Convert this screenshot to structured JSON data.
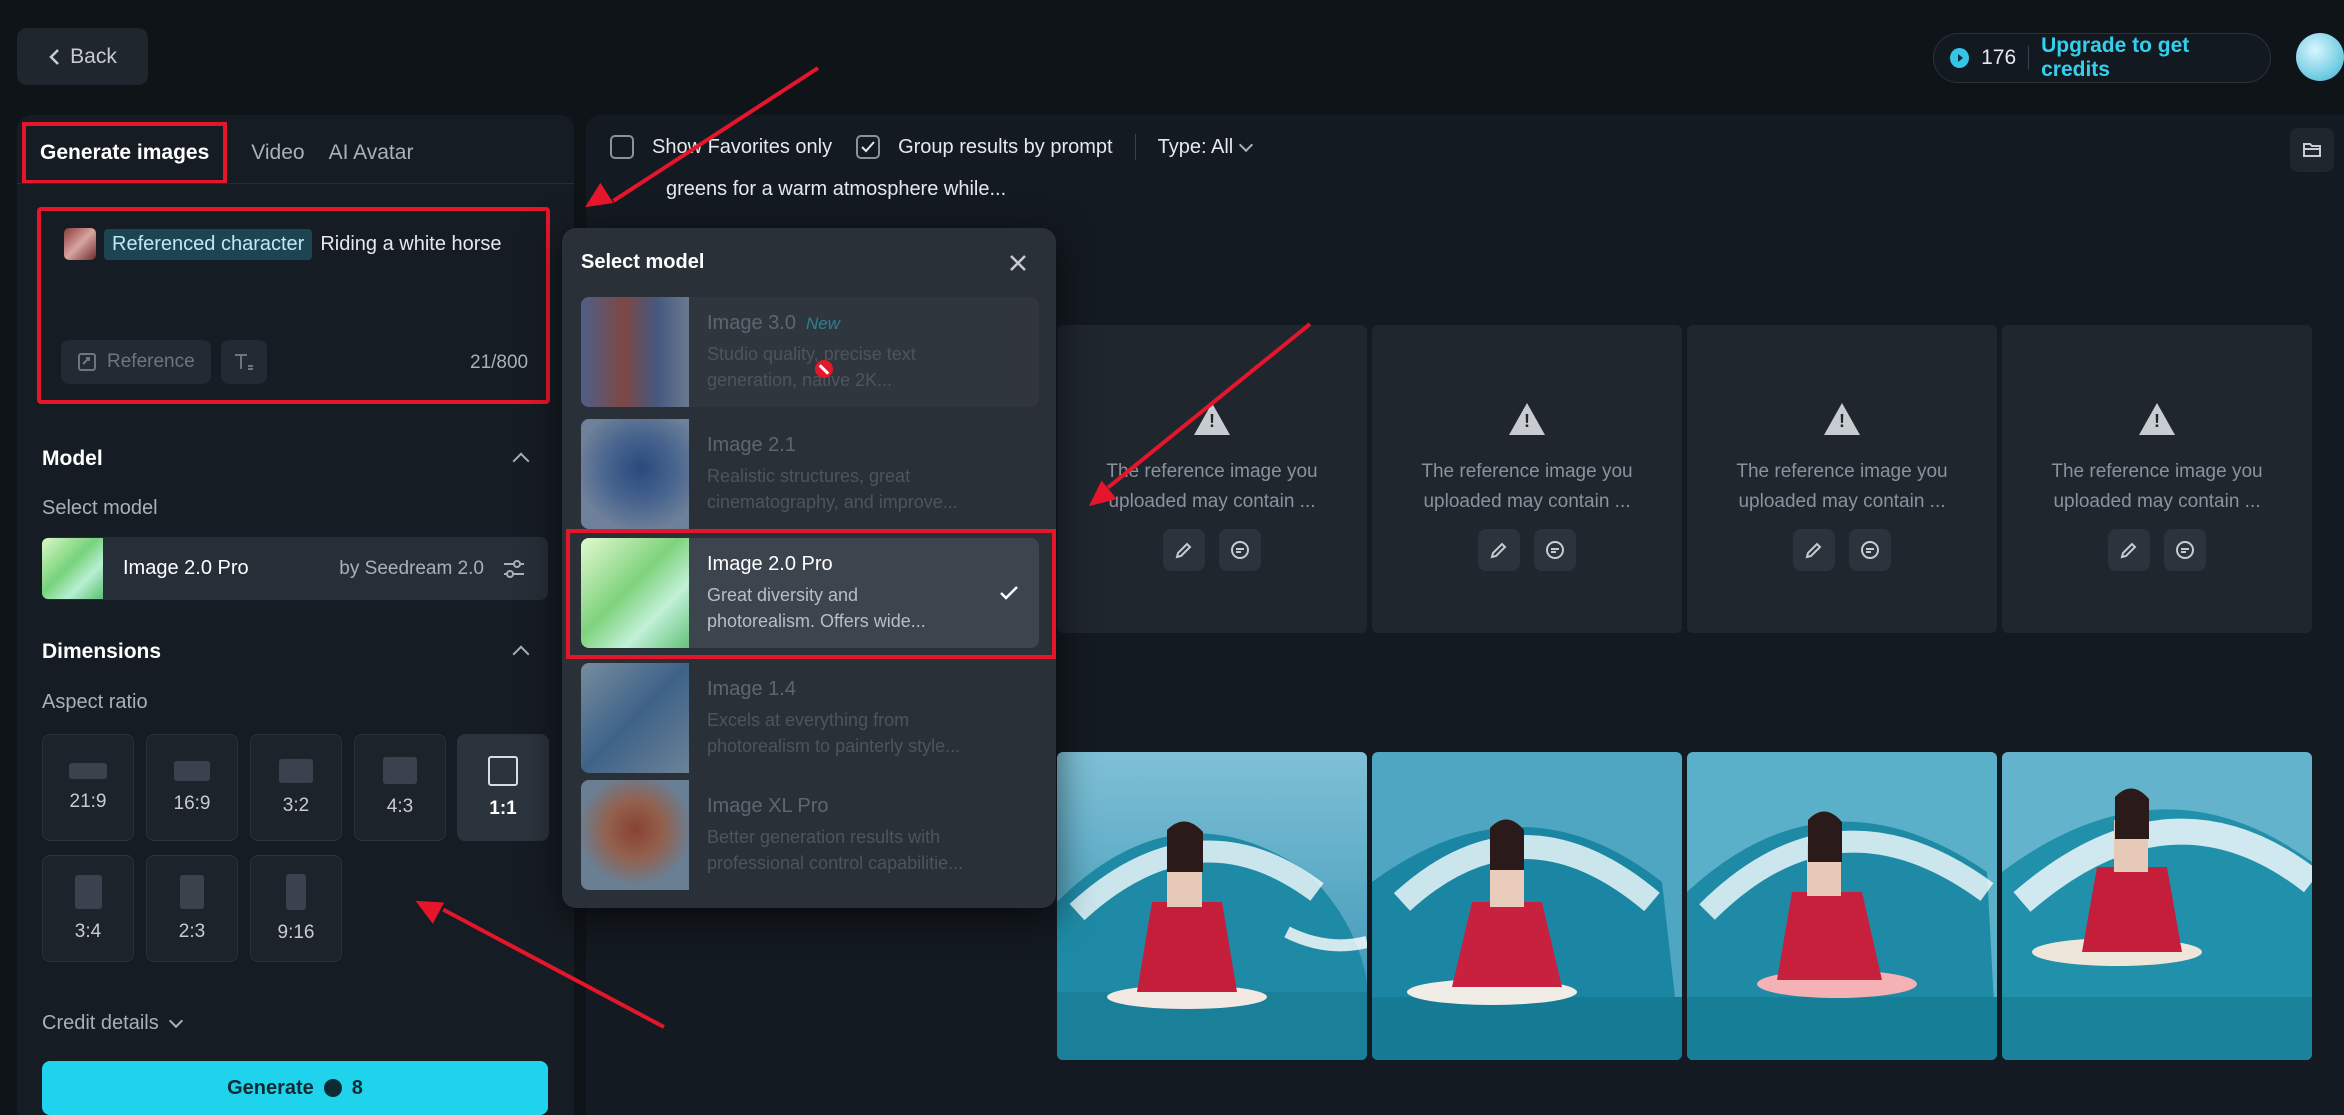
{
  "header": {
    "back_label": "Back",
    "credits": "176",
    "upgrade_label": "Upgrade to get credits"
  },
  "tabs": [
    {
      "label": "Generate images",
      "active": true
    },
    {
      "label": "Video"
    },
    {
      "label": "AI Avatar"
    }
  ],
  "prompt": {
    "chip_label": "Referenced character",
    "text": "Riding a white horse",
    "reference_label": "Reference",
    "char_count": "21/800"
  },
  "model_section": {
    "title": "Model",
    "select_label": "Select model",
    "selected_name": "Image 2.0 Pro",
    "selected_by": "by Seedream 2.0"
  },
  "dimensions": {
    "title": "Dimensions",
    "aspect_label": "Aspect ratio",
    "ratios": [
      "21:9",
      "16:9",
      "3:2",
      "4:3",
      "1:1",
      "3:4",
      "2:3",
      "9:16"
    ],
    "active": "1:1"
  },
  "footer": {
    "credit_details": "Credit details",
    "generate_label": "Generate",
    "generate_cost": "8"
  },
  "filters": {
    "favorites": "Show Favorites only",
    "group": "Group results by prompt",
    "type": "Type: All"
  },
  "prompt_snippet": "greens for a warm atmosphere while...",
  "warning_card": {
    "line1": "The reference image you",
    "line2": "uploaded may contain ..."
  },
  "popup": {
    "title": "Select model",
    "options": [
      {
        "name": "Image 3.0",
        "tag": "New",
        "desc1": "Studio quality, precise text",
        "desc2": "generation, native 2K..."
      },
      {
        "name": "Image 2.1",
        "desc1": "Realistic structures, great",
        "desc2": "cinematography, and improve..."
      },
      {
        "name": "Image 2.0 Pro",
        "desc1": "Great diversity and",
        "desc2": "photorealism. Offers wide...",
        "selected": true
      },
      {
        "name": "Image 1.4",
        "desc1": "Excels at everything from",
        "desc2": "photorealism to painterly style..."
      },
      {
        "name": "Image XL Pro",
        "desc1": "Better generation results with",
        "desc2": "professional control capabilitie..."
      }
    ]
  },
  "colors": {
    "accent": "#1fd3ec",
    "annotation_red": "#e5162b",
    "background": "#0f1419"
  }
}
